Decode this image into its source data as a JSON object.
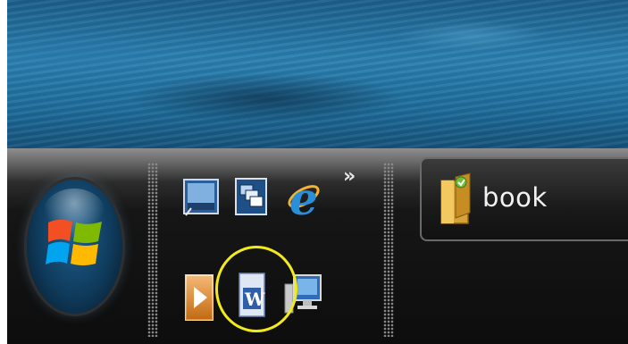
{
  "desktop": {
    "wallpaper": "ocean-wave"
  },
  "taskbar": {
    "start_button": {
      "icon": "windows-logo"
    },
    "quick_launch": {
      "row1": [
        {
          "icon": "show-desktop-icon"
        },
        {
          "icon": "switch-windows-icon"
        },
        {
          "icon": "internet-explorer-icon"
        }
      ],
      "row2": [
        {
          "icon": "media-player-icon"
        },
        {
          "icon": "microsoft-word-icon"
        },
        {
          "icon": "computer-icon"
        }
      ],
      "overflow_label": "»"
    },
    "task_buttons": [
      {
        "label": "book",
        "icon": "folder-icon"
      }
    ]
  },
  "annotation": {
    "color": "#f3ea1b",
    "target": "microsoft-word-icon"
  }
}
